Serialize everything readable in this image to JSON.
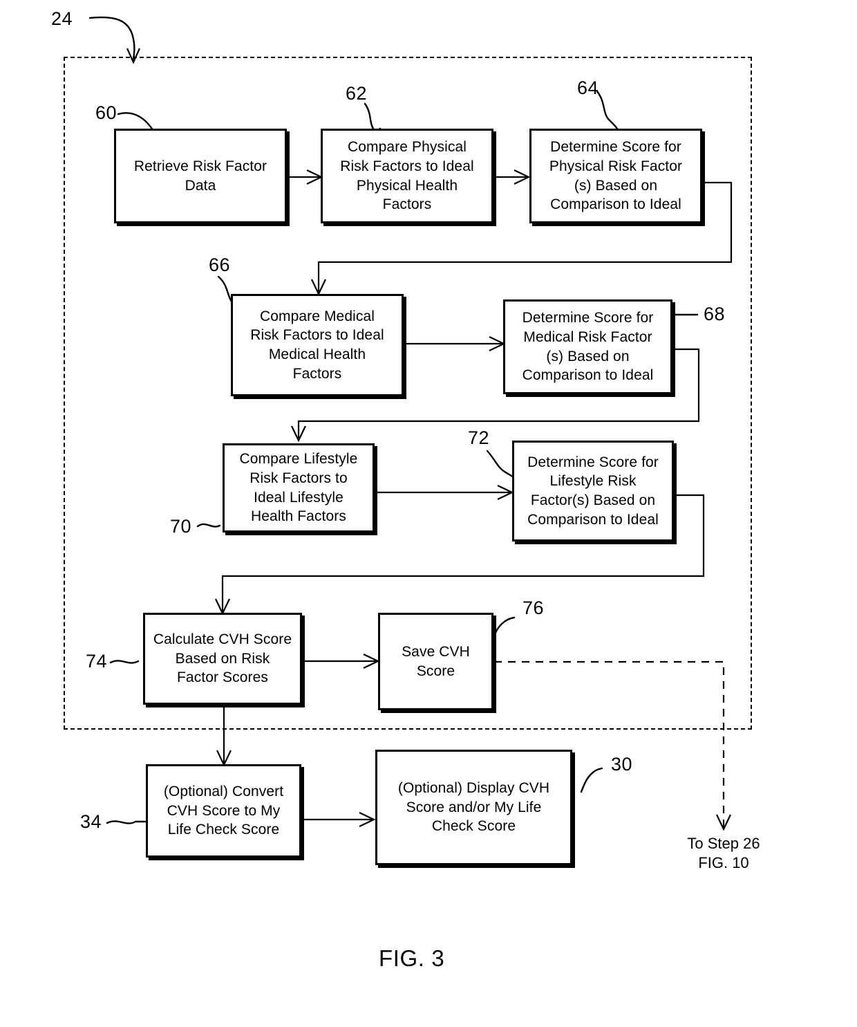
{
  "figure": {
    "caption": "FIG. 3",
    "container_ref": "24"
  },
  "boxes": [
    {
      "ref": "60",
      "label": "Retrieve Risk Factor\nData"
    },
    {
      "ref": "62",
      "label": "Compare Physical\nRisk Factors to  Ideal\nPhysical Health\nFactors"
    },
    {
      "ref": "64",
      "label": "Determine Score for\nPhysical Risk Factor\n(s) Based on\nComparison to Ideal"
    },
    {
      "ref": "66",
      "label": "Compare Medical\nRisk Factors to  Ideal\nMedical Health\nFactors"
    },
    {
      "ref": "68",
      "label": "Determine Score  for\nMedical Risk Factor\n(s) Based on\nComparison to Ideal"
    },
    {
      "ref": "70",
      "label": "Compare Lifestyle\nRisk Factors to\nIdeal Lifestyle\nHealth Factors"
    },
    {
      "ref": "72",
      "label": "Determine Score for\nLifestyle Risk\nFactor(s) Based on\nComparison to Ideal"
    },
    {
      "ref": "74",
      "label": "Calculate CVH Score\nBased on Risk\nFactor Scores"
    },
    {
      "ref": "76",
      "label": "Save CVH\nScore"
    },
    {
      "ref": "34",
      "label": "(Optional) Convert\nCVH Score to My\nLife Check Score"
    },
    {
      "ref": "30",
      "label": "(Optional) Display CVH\nScore and/or My Life\nCheck Score"
    }
  ],
  "exit": {
    "label": "To  Step 26\nFIG. 10"
  },
  "colors": {
    "stroke": "#000000",
    "background": "#ffffff"
  }
}
